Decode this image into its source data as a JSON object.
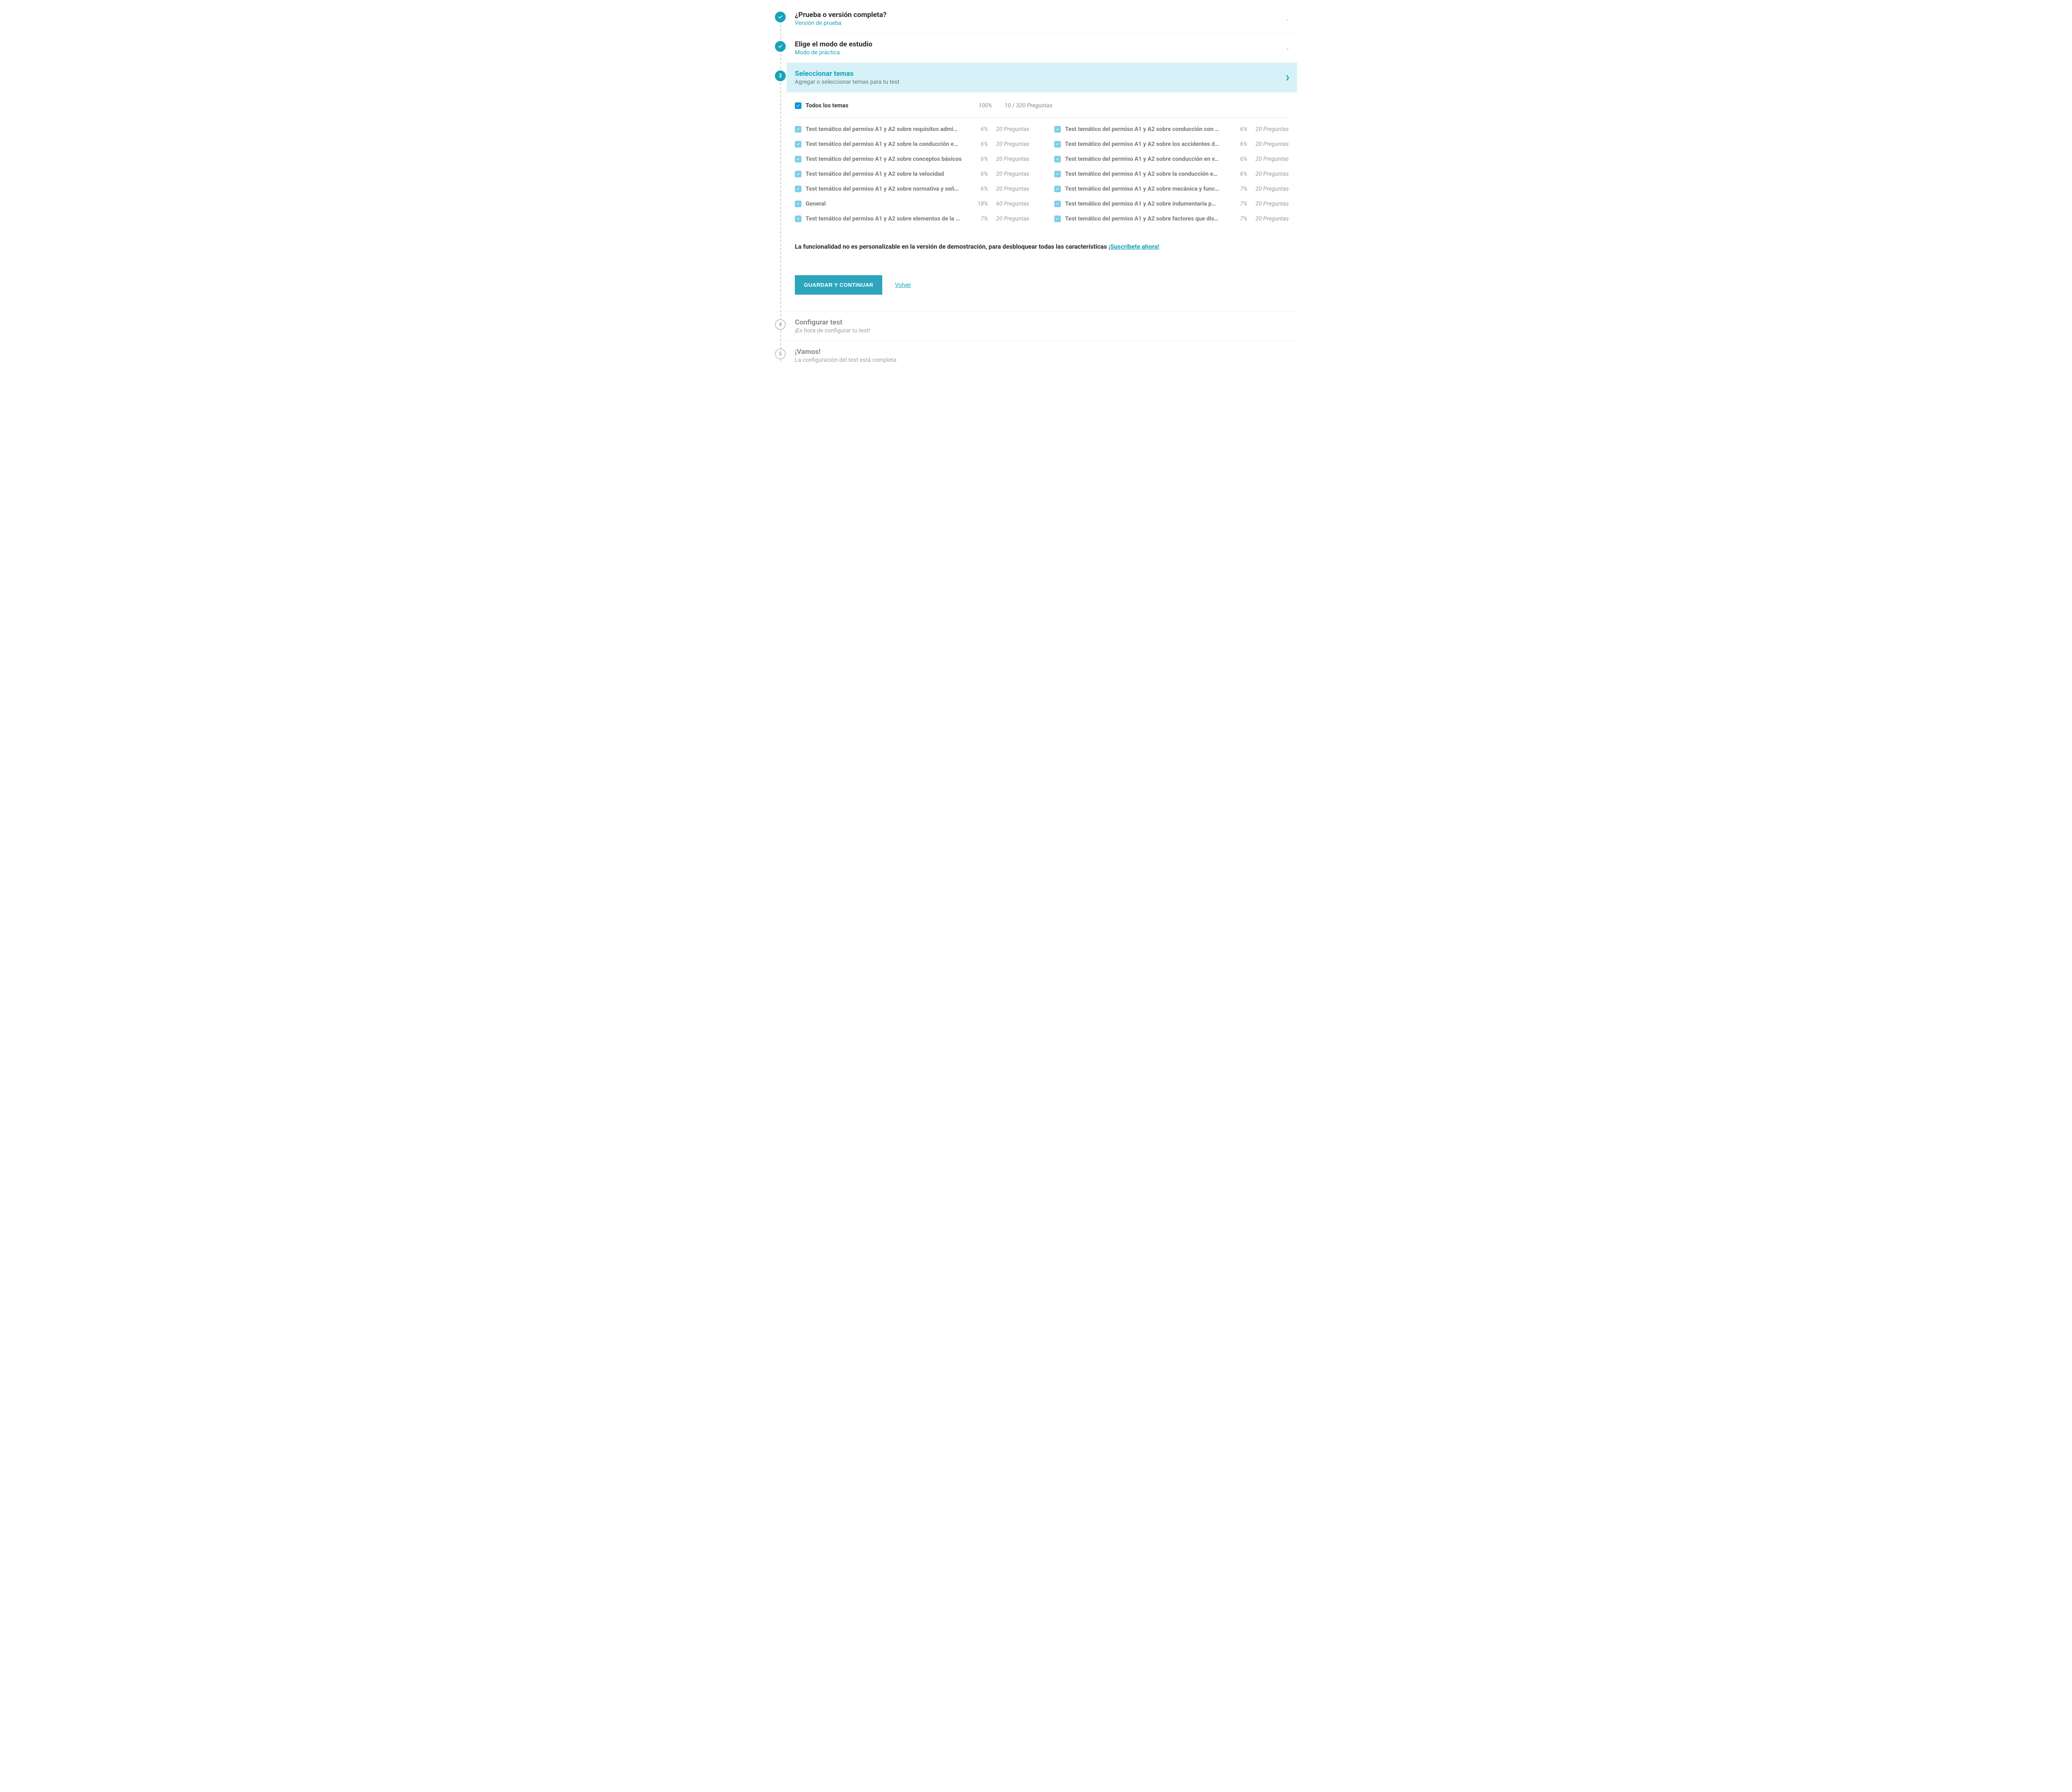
{
  "steps": {
    "s1": {
      "title": "¿Prueba o versión completa?",
      "sub": "Versión de prueba"
    },
    "s2": {
      "title": "Elige el modo de estudio",
      "sub": "Modo de práctica"
    },
    "s3": {
      "title": "Seleccionar temas",
      "sub": "Agregar o seleccionar temas para tu test",
      "num": "3"
    },
    "s4": {
      "title": "Configurar test",
      "sub": "¡Es hora de configurar tu test!",
      "num": "4"
    },
    "s5": {
      "title": "¡Vamos!",
      "sub": "La configuración del test está completa",
      "num": "5"
    }
  },
  "topicsHeader": {
    "label": "Todos los temas",
    "pct": "100%",
    "count": "10 / 320 Preguntas"
  },
  "topicsLeft": [
    {
      "label": "Test temático del permiso A1 y A2 sobre requisitos admi…",
      "pct": "6%",
      "count": "20 Preguntas"
    },
    {
      "label": "Test temático del permiso A1 y A2 sobre la conducción e…",
      "pct": "6%",
      "count": "20 Preguntas"
    },
    {
      "label": "Test temático del permiso A1 y A2 sobre conceptos básicos",
      "pct": "6%",
      "count": "20 Preguntas"
    },
    {
      "label": "Test temático del permiso A1 y A2 sobre la velocidad",
      "pct": "6%",
      "count": "20 Preguntas"
    },
    {
      "label": "Test temático del permiso A1 y A2 sobre normativa y señ…",
      "pct": "6%",
      "count": "20 Preguntas"
    },
    {
      "label": "General",
      "pct": "18%",
      "count": "60 Preguntas"
    },
    {
      "label": "Test temático del permiso A1 y A2 sobre elementos de la …",
      "pct": "7%",
      "count": "20 Preguntas"
    }
  ],
  "topicsRight": [
    {
      "label": "Test temático del permiso A1 y A2 sobre conducción con …",
      "pct": "6%",
      "count": "20 Preguntas"
    },
    {
      "label": "Test temático del permiso A1 y A2 sobre los accidentes d…",
      "pct": "6%",
      "count": "20 Preguntas"
    },
    {
      "label": "Test temático del permiso A1 y A2 sobre conducción en v…",
      "pct": "6%",
      "count": "20 Preguntas"
    },
    {
      "label": "Test temático del permiso A1 y A2 sobre la conducción e…",
      "pct": "6%",
      "count": "20 Preguntas"
    },
    {
      "label": "Test temático del permiso A1 y A2 sobre mecánica y func…",
      "pct": "7%",
      "count": "20 Preguntas"
    },
    {
      "label": "Test temático del permiso A1 y A2 sobre indumentaria p…",
      "pct": "7%",
      "count": "20 Preguntas"
    },
    {
      "label": "Test temático del permiso A1 y A2 sobre factores que dis…",
      "pct": "7%",
      "count": "20 Preguntas"
    }
  ],
  "demoNote": {
    "text": "La funcionalidad no es personalizable en la versión de demostración, para desbloquear todas las características ",
    "link": "¡Suscríbete ahora!"
  },
  "actions": {
    "save": "GUARDAR Y CONTINUAR",
    "back": "Volver"
  }
}
